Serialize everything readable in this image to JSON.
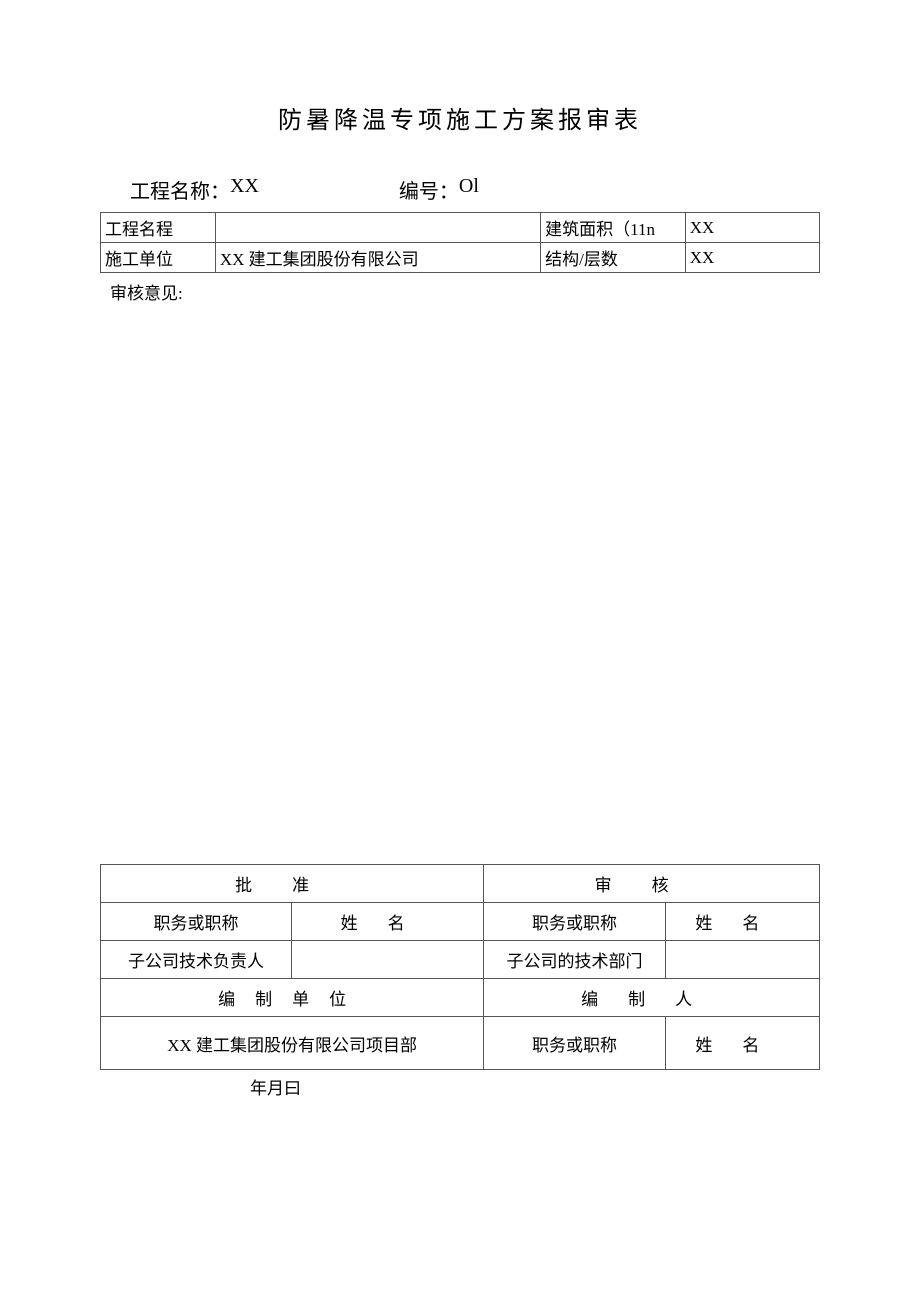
{
  "title": "防暑降温专项施工方案报审表",
  "header": {
    "proj_label": "工程名称：",
    "proj_value": "XX",
    "number_label": "编号：",
    "number_value": "Ol"
  },
  "info_table": {
    "r1c1": "工程名程",
    "r1c2": "",
    "r1c3": "建筑面积（11n",
    "r1c4": "XX",
    "r2c1": "施工单位",
    "r2c2": "XX 建工集团股份有限公司",
    "r2c3": "结构/层数",
    "r2c4": "XX"
  },
  "review_label": "审核意见:",
  "bottom_table": {
    "approve_header": "批准",
    "review_header": "审核",
    "post_label_a": "职务或职称",
    "name_label_a": "姓名",
    "post_label_b": "职务或职称",
    "name_label_b": "姓名",
    "tech_leader": "子公司技术负责人",
    "tech_leader_name": "",
    "tech_dept": "子公司的技术部门",
    "tech_dept_name": "",
    "compile_unit_label": "编制单位",
    "compile_person_label": "编制人",
    "unit_value": "XX 建工集团股份有限公司项目部",
    "post_label_c": "职务或职称",
    "name_label_c": "姓名"
  },
  "date_line": "年月曰"
}
